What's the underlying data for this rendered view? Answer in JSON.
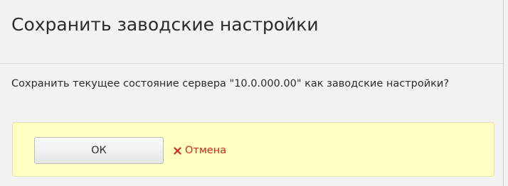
{
  "dialog": {
    "title": "Сохранить заводские настройки",
    "message": "Сохранить текущее состояние сервера \"10.0.000.00\" как заводские настройки?",
    "ok_label": "ОК",
    "cancel_label": "Отмена",
    "cancel_icon": "close-icon",
    "colors": {
      "button_bar_background": "#ffffc2",
      "cancel_text": "#cc2a1e",
      "background": "#f2f2f2"
    }
  }
}
